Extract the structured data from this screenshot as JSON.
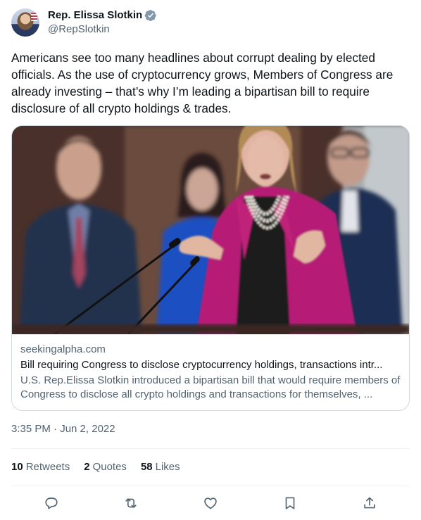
{
  "author": {
    "display_name": "Rep. Elissa Slotkin",
    "handle": "@RepSlotkin",
    "verified_icon": "verified-badge-icon",
    "verified_color": "#829aab"
  },
  "tweet": {
    "text": "Americans see too many headlines about corrupt dealing by elected officials. As the use of cryptocurrency grows, Members of Congress are already investing – that’s why I’m leading a bipartisan bill to require disclosure of all crypto holdings & trades.",
    "timestamp": "3:35 PM · Jun 2, 2022"
  },
  "link_card": {
    "domain": "seekingalpha.com",
    "title": "Bill requiring Congress to disclose cryptocurrency holdings, transactions intr...",
    "description": "U.S. Rep.Elissa Slotkin introduced a bipartisan bill that would require members of Congress to disclose all crypto holdings and transactions for themselves, ..."
  },
  "stats": {
    "retweets_count": "10",
    "retweets_label": "Retweets",
    "quotes_count": "2",
    "quotes_label": "Quotes",
    "likes_count": "58",
    "likes_label": "Likes"
  },
  "actions": [
    "reply-icon",
    "retweet-icon",
    "like-icon",
    "bookmark-icon",
    "share-icon"
  ],
  "colors": {
    "text_primary": "#0f1419",
    "text_secondary": "#536471",
    "border": "#cfd9de",
    "divider": "#eff3f4",
    "accent_pink": "#c0207a"
  }
}
